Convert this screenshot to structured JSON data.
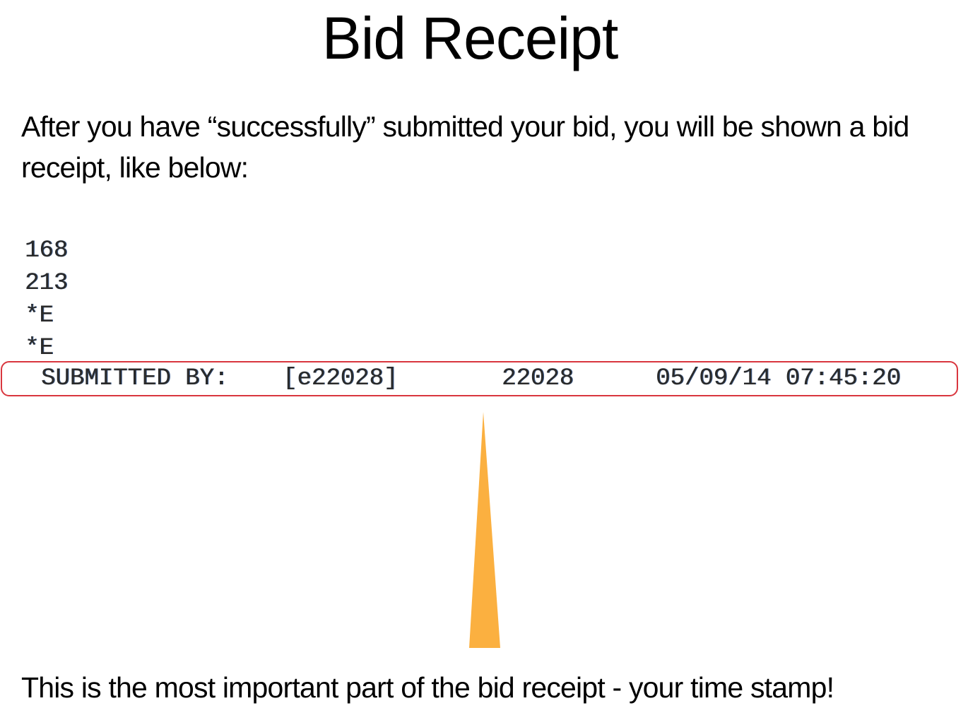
{
  "title": "Bid Receipt",
  "intro": "After you have “successfully” submitted your bid, you will be shown a bid receipt, like below:",
  "receipt": {
    "lines": [
      "168",
      "213",
      "*E",
      "*E"
    ],
    "submitted_label": "SUBMITTED BY:",
    "user": "[e22028]",
    "id": "22028",
    "timestamp": "05/09/14 07:45:20"
  },
  "highlight": {
    "box_color": "#d9363e",
    "pointer_color": "#fbb040",
    "pointer_icon": "upward-pointer-icon"
  },
  "note": "This is the most important part of the bid receipt - your time stamp!"
}
